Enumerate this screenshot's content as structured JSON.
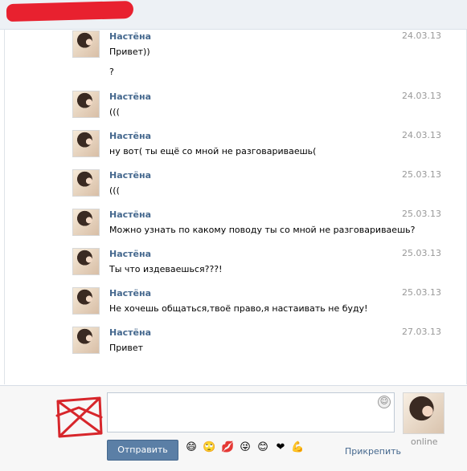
{
  "header": {},
  "messages": [
    {
      "author": "Настёна",
      "date": "24.03.13",
      "lines": [
        "Привет))",
        "?"
      ]
    },
    {
      "author": "Настёна",
      "date": "24.03.13",
      "lines": [
        "((("
      ]
    },
    {
      "author": "Настёна",
      "date": "24.03.13",
      "lines": [
        "ну вот( ты ещё со мной не разговариваешь("
      ]
    },
    {
      "author": "Настёна",
      "date": "25.03.13",
      "lines": [
        "((("
      ]
    },
    {
      "author": "Настёна",
      "date": "25.03.13",
      "lines": [
        "Можно узнать по какому поводу ты со мной не разговариваешь?"
      ]
    },
    {
      "author": "Настёна",
      "date": "25.03.13",
      "lines": [
        "Ты что издеваешься???!"
      ]
    },
    {
      "author": "Настёна",
      "date": "25.03.13",
      "lines": [
        "Не хочешь общаться,твоё право,я настаивать не буду!"
      ]
    },
    {
      "author": "Настёна",
      "date": "27.03.13",
      "lines": [
        "Привет"
      ]
    }
  ],
  "composer": {
    "send_label": "Отправить",
    "attach_label": "Прикрепить",
    "online_label": "online",
    "emojis": [
      "smile-emoji",
      "rolling-eyes-emoji",
      "kiss-lips-emoji",
      "wink-tongue-emoji",
      "grin-emoji",
      "heart-emoji",
      "muscle-emoji"
    ]
  },
  "colors": {
    "accent": "#45688e",
    "button": "#5b7fa6",
    "redaction": "#e8212f"
  }
}
